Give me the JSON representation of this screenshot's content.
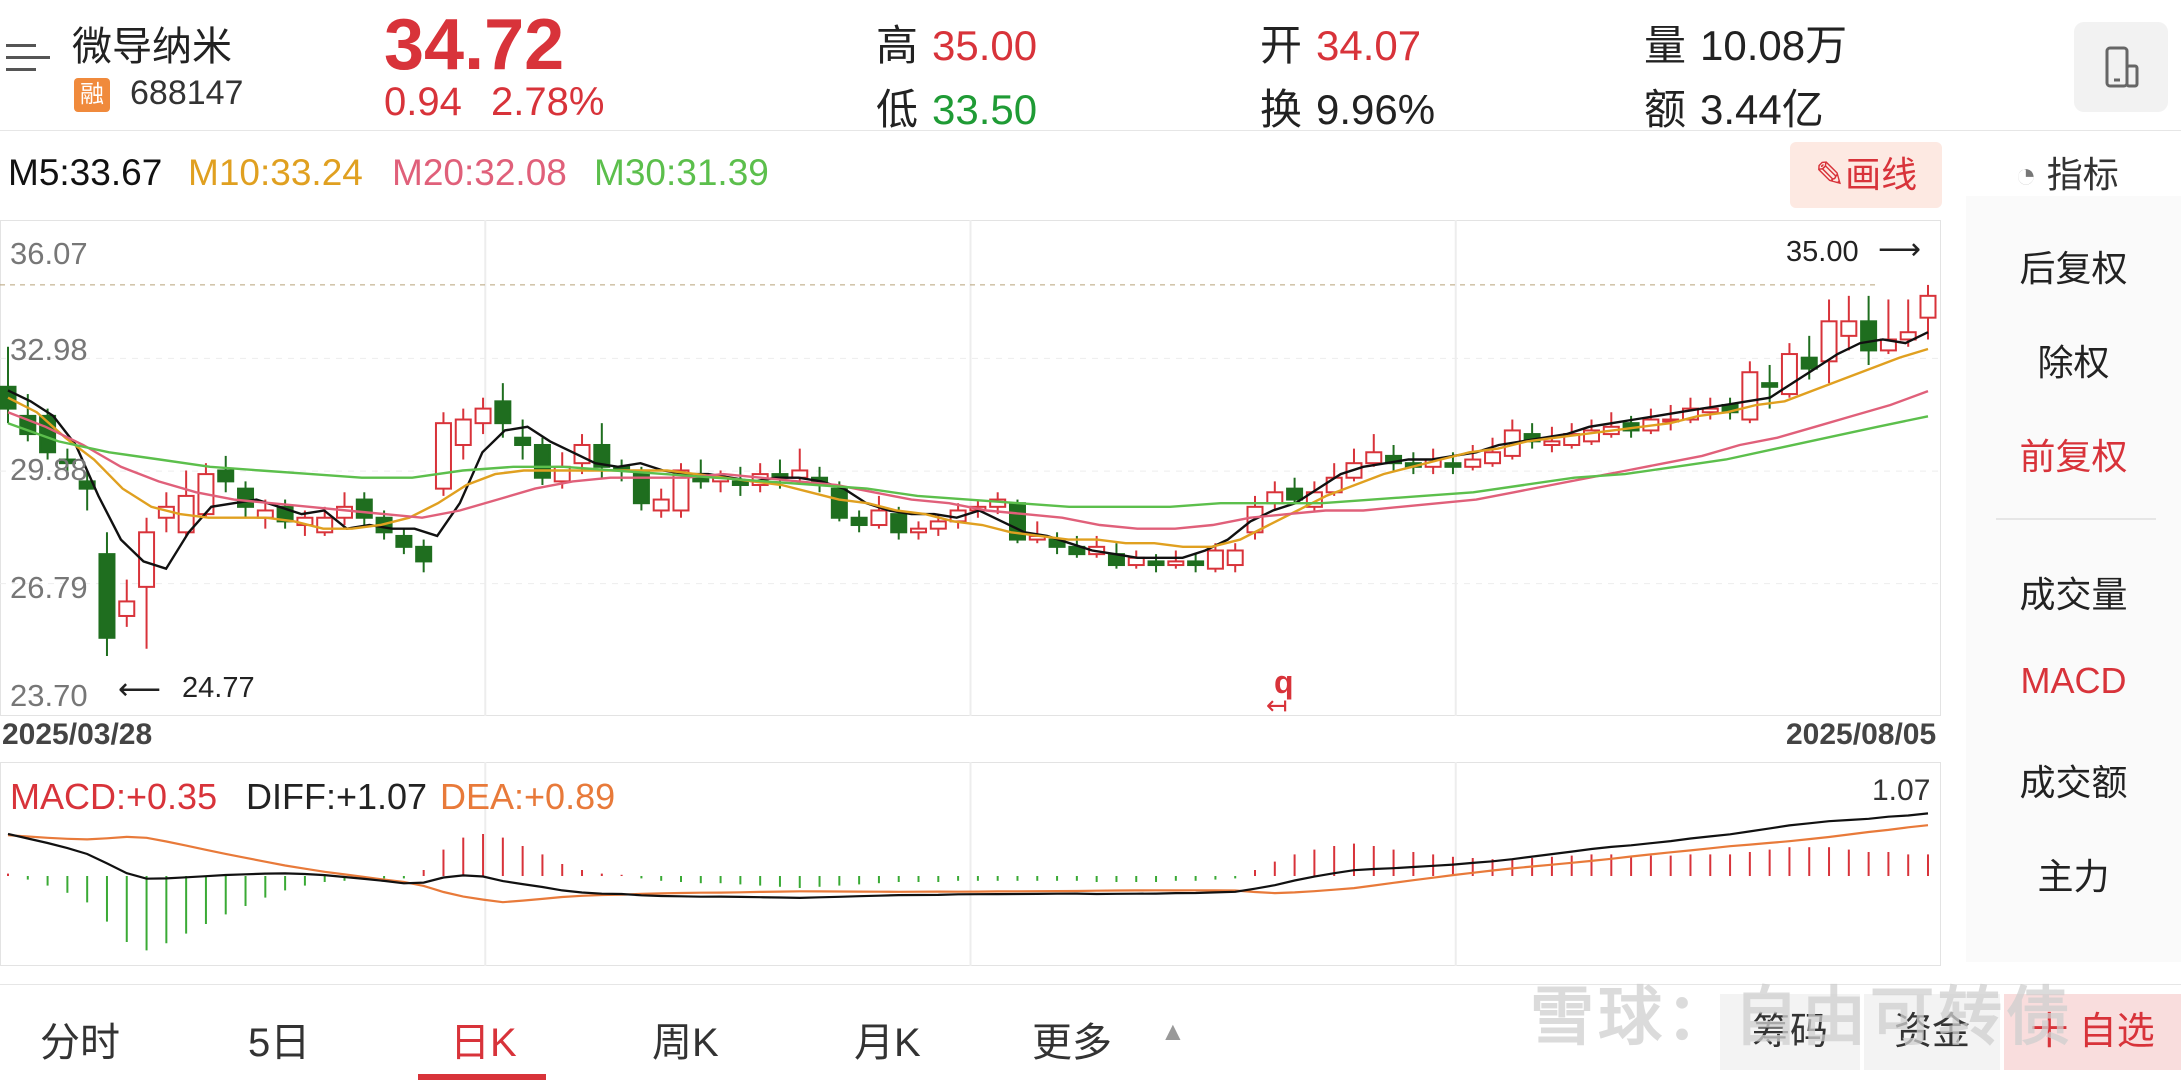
{
  "stock": {
    "name": "微导纳米",
    "badge": "融",
    "code": "688147",
    "price": "34.72",
    "change": "0.94",
    "change_pct": "2.78%"
  },
  "stats": {
    "high_label": "高",
    "high": "35.00",
    "low_label": "低",
    "low": "33.50",
    "open_label": "开",
    "open": "34.07",
    "turnover_label": "换",
    "turnover": "9.96%",
    "volume_label": "量",
    "volume": "10.08万",
    "amount_label": "额",
    "amount": "3.44亿"
  },
  "ma": {
    "m5": "M5:33.67",
    "m10": "M10:33.24",
    "m20": "M20:32.08",
    "m30": "M30:31.39"
  },
  "toolbar": {
    "draw_label": "画线",
    "indicator_label": "指标"
  },
  "side_menu": {
    "items": [
      "后复权",
      "除权",
      "前复权",
      "成交量",
      "MACD",
      "成交额",
      "主力"
    ],
    "active": [
      "前复权",
      "MACD"
    ]
  },
  "chart": {
    "y_ticks": [
      "36.07",
      "32.98",
      "29.88",
      "26.79",
      "23.70"
    ],
    "max_label": "35.00",
    "min_label": "24.77",
    "start_date": "2025/03/28",
    "end_date": "2025/08/05",
    "marker_label": "q"
  },
  "macd": {
    "macd": "MACD:+0.35",
    "diff": "DIFF:+1.07",
    "dea": "DEA:+0.89",
    "top_value": "1.07"
  },
  "tabs": [
    "分时",
    "5日",
    "日K",
    "周K",
    "月K",
    "更多"
  ],
  "active_tab": "日K",
  "bottom_buttons": {
    "chips": "筹码",
    "funds": "资金",
    "add": "十 自选"
  },
  "watermark": "雪球：自由可转债",
  "colors": {
    "up": "#d8333a",
    "down": "#1f6e1f",
    "m5": "#111111",
    "m10": "#e0a020",
    "m20": "#e0607a",
    "m30": "#5cbf4c",
    "dea": "#e87a3a"
  },
  "chart_data": {
    "type": "candlestick",
    "ylim": [
      23.7,
      36.07
    ],
    "candles": [
      [
        32.2,
        31.6,
        33.3,
        31.2
      ],
      [
        31.4,
        30.9,
        32.0,
        30.7
      ],
      [
        31.4,
        30.4,
        31.6,
        30.2
      ],
      [
        30.2,
        30.1,
        30.5,
        29.8
      ],
      [
        29.6,
        29.4,
        29.9,
        28.8
      ],
      [
        27.6,
        25.3,
        28.2,
        24.8
      ],
      [
        25.9,
        26.3,
        26.9,
        25.6
      ],
      [
        26.7,
        28.2,
        28.6,
        25.0
      ],
      [
        28.6,
        28.9,
        29.3,
        28.2
      ],
      [
        28.2,
        29.2,
        29.9,
        28.1
      ],
      [
        28.7,
        29.8,
        30.1,
        28.6
      ],
      [
        29.9,
        29.6,
        30.3,
        29.3
      ],
      [
        29.4,
        28.9,
        29.6,
        28.6
      ],
      [
        28.6,
        28.8,
        29.1,
        28.3
      ],
      [
        28.9,
        28.5,
        29.1,
        28.3
      ],
      [
        28.4,
        28.6,
        28.8,
        28.1
      ],
      [
        28.2,
        28.6,
        28.9,
        28.1
      ],
      [
        28.6,
        28.9,
        29.3,
        28.4
      ],
      [
        29.1,
        28.6,
        29.3,
        28.4
      ],
      [
        28.6,
        28.2,
        28.8,
        28.0
      ],
      [
        28.1,
        27.8,
        28.3,
        27.6
      ],
      [
        27.8,
        27.4,
        28.0,
        27.1
      ],
      [
        29.4,
        31.2,
        31.5,
        29.2
      ],
      [
        30.6,
        31.3,
        31.6,
        30.2
      ],
      [
        31.2,
        31.6,
        31.9,
        30.9
      ],
      [
        31.8,
        31.2,
        32.3,
        30.8
      ],
      [
        30.8,
        30.6,
        31.3,
        30.2
      ],
      [
        30.6,
        29.7,
        30.8,
        29.5
      ],
      [
        29.6,
        30.0,
        30.4,
        29.4
      ],
      [
        30.1,
        30.6,
        30.9,
        29.8
      ],
      [
        30.6,
        30.0,
        31.2,
        29.7
      ],
      [
        30.0,
        29.9,
        30.2,
        29.6
      ],
      [
        29.9,
        29.0,
        30.0,
        28.8
      ],
      [
        28.8,
        29.1,
        29.4,
        28.6
      ],
      [
        28.8,
        29.9,
        30.1,
        28.6
      ],
      [
        29.8,
        29.6,
        30.2,
        29.4
      ],
      [
        29.6,
        29.7,
        29.9,
        29.3
      ],
      [
        29.6,
        29.5,
        30.0,
        29.2
      ],
      [
        29.5,
        29.8,
        30.1,
        29.3
      ],
      [
        29.8,
        29.7,
        30.2,
        29.4
      ],
      [
        29.7,
        29.9,
        30.5,
        29.5
      ],
      [
        29.7,
        29.6,
        30.0,
        29.3
      ],
      [
        29.4,
        28.6,
        29.6,
        28.5
      ],
      [
        28.6,
        28.4,
        28.8,
        28.2
      ],
      [
        28.4,
        28.8,
        29.2,
        28.3
      ],
      [
        28.7,
        28.2,
        28.9,
        28.0
      ],
      [
        28.2,
        28.3,
        28.5,
        28.0
      ],
      [
        28.3,
        28.5,
        28.7,
        28.1
      ],
      [
        28.5,
        28.8,
        29.0,
        28.3
      ],
      [
        28.8,
        28.9,
        29.1,
        28.6
      ],
      [
        28.9,
        29.1,
        29.3,
        28.7
      ],
      [
        29.0,
        28.0,
        29.1,
        27.9
      ],
      [
        28.0,
        28.1,
        28.5,
        27.9
      ],
      [
        28.0,
        27.8,
        28.2,
        27.6
      ],
      [
        27.8,
        27.6,
        28.1,
        27.5
      ],
      [
        27.6,
        27.8,
        28.1,
        27.5
      ],
      [
        27.6,
        27.3,
        27.9,
        27.2
      ],
      [
        27.3,
        27.5,
        27.7,
        27.2
      ],
      [
        27.4,
        27.3,
        27.6,
        27.1
      ],
      [
        27.3,
        27.4,
        27.7,
        27.2
      ],
      [
        27.4,
        27.3,
        27.6,
        27.1
      ],
      [
        27.2,
        27.7,
        27.9,
        27.1
      ],
      [
        27.3,
        27.7,
        27.9,
        27.1
      ],
      [
        28.2,
        28.9,
        29.2,
        28.0
      ],
      [
        29.0,
        29.3,
        29.6,
        28.8
      ],
      [
        29.4,
        29.1,
        29.7,
        29.0
      ],
      [
        28.9,
        29.3,
        29.6,
        28.8
      ],
      [
        29.3,
        29.7,
        30.1,
        29.2
      ],
      [
        29.7,
        30.1,
        30.5,
        29.6
      ],
      [
        30.1,
        30.4,
        30.9,
        30.0
      ],
      [
        30.3,
        30.1,
        30.6,
        29.9
      ],
      [
        30.1,
        30.0,
        30.4,
        29.8
      ],
      [
        30.0,
        30.2,
        30.5,
        29.8
      ],
      [
        30.1,
        30.0,
        30.4,
        29.8
      ],
      [
        30.0,
        30.2,
        30.6,
        29.9
      ],
      [
        30.1,
        30.4,
        30.8,
        30.0
      ],
      [
        30.3,
        31.0,
        31.3,
        30.2
      ],
      [
        30.9,
        30.7,
        31.2,
        30.5
      ],
      [
        30.6,
        30.7,
        31.1,
        30.4
      ],
      [
        30.6,
        30.9,
        31.2,
        30.5
      ],
      [
        30.7,
        31.0,
        31.3,
        30.6
      ],
      [
        30.9,
        31.1,
        31.5,
        30.8
      ],
      [
        31.2,
        31.0,
        31.4,
        30.8
      ],
      [
        31.0,
        31.3,
        31.6,
        30.9
      ],
      [
        31.3,
        31.3,
        31.7,
        31.0
      ],
      [
        31.3,
        31.6,
        31.9,
        31.2
      ],
      [
        31.5,
        31.6,
        31.9,
        31.3
      ],
      [
        31.7,
        31.5,
        31.9,
        31.3
      ],
      [
        31.3,
        32.6,
        32.9,
        31.2
      ],
      [
        32.3,
        32.2,
        32.8,
        31.6
      ],
      [
        32.0,
        33.1,
        33.4,
        31.9
      ],
      [
        33.0,
        32.7,
        33.6,
        32.4
      ],
      [
        32.9,
        34.0,
        34.6,
        32.3
      ],
      [
        33.6,
        34.0,
        34.7,
        33.2
      ],
      [
        34.0,
        33.2,
        34.7,
        32.8
      ],
      [
        33.2,
        33.5,
        34.6,
        33.1
      ],
      [
        33.5,
        33.7,
        34.6,
        33.3
      ],
      [
        34.1,
        34.7,
        35.0,
        33.5
      ]
    ],
    "ma_lines": [
      {
        "name": "M5",
        "values": [
          32.1,
          31.8,
          31.4,
          30.6,
          29.2,
          28.0,
          27.4,
          27.2,
          28.2,
          28.9,
          29.0,
          29.1,
          28.9,
          28.7,
          28.8,
          28.3,
          28.4,
          28.3,
          28.3,
          28.1,
          29.0,
          30.4,
          31.0,
          31.1,
          30.7,
          30.4,
          30.1,
          30.0,
          30.1,
          29.9,
          29.8,
          29.8,
          29.7,
          29.6,
          29.7,
          29.7,
          29.6,
          29.4,
          29.0,
          28.8,
          28.7,
          28.7,
          28.6,
          28.8,
          28.5,
          28.2,
          28.1,
          27.9,
          27.7,
          27.6,
          27.5,
          27.5,
          27.5,
          27.7,
          28.0,
          28.5,
          28.8,
          29.0,
          29.4,
          29.8,
          30.0,
          30.1,
          30.2,
          30.2,
          30.3,
          30.4,
          30.6,
          30.7,
          30.8,
          30.9,
          31.1,
          31.2,
          31.3,
          31.4,
          31.5,
          31.6,
          31.7,
          31.8,
          31.9,
          32.3,
          32.7,
          33.1,
          33.4,
          33.5,
          33.4,
          33.7
        ]
      },
      {
        "name": "M10",
        "values": [
          31.9,
          31.5,
          30.8,
          30.2,
          29.4,
          28.9,
          28.7,
          28.6,
          28.6,
          28.6,
          28.5,
          28.3,
          28.3,
          28.4,
          28.6,
          29.0,
          29.5,
          29.8,
          29.9,
          29.9,
          29.9,
          29.9,
          29.9,
          29.9,
          29.8,
          29.7,
          29.6,
          29.5,
          29.3,
          29.1,
          29.0,
          28.8,
          28.7,
          28.5,
          28.4,
          28.2,
          28.1,
          28.0,
          28.0,
          27.9,
          27.9,
          27.8,
          27.8,
          28.0,
          28.4,
          28.8,
          29.2,
          29.5,
          29.8,
          30.0,
          30.2,
          30.4,
          30.5,
          30.7,
          30.8,
          30.9,
          31.0,
          31.1,
          31.2,
          31.4,
          31.5,
          31.7,
          31.8,
          32.1,
          32.4,
          32.7,
          33.0,
          33.24
        ]
      },
      {
        "name": "M20",
        "values": [
          31.5,
          31.1,
          30.6,
          30.0,
          29.6,
          29.3,
          29.1,
          29.0,
          28.9,
          28.8,
          28.7,
          28.6,
          28.8,
          29.1,
          29.4,
          29.6,
          29.7,
          29.7,
          29.7,
          29.8,
          29.7,
          29.6,
          29.5,
          29.3,
          29.1,
          29.0,
          28.8,
          28.7,
          28.6,
          28.4,
          28.3,
          28.3,
          28.4,
          28.6,
          28.7,
          28.8,
          28.8,
          28.9,
          29.0,
          29.1,
          29.3,
          29.5,
          29.7,
          29.9,
          30.1,
          30.3,
          30.6,
          30.8,
          31.1,
          31.4,
          31.7,
          32.08
        ]
      },
      {
        "name": "M30",
        "values": [
          31.2,
          30.7,
          30.4,
          30.2,
          30.0,
          29.9,
          29.8,
          29.7,
          29.7,
          29.9,
          30.0,
          30.0,
          29.9,
          29.8,
          29.7,
          29.6,
          29.5,
          29.4,
          29.2,
          29.1,
          29.0,
          28.9,
          28.9,
          28.9,
          29.0,
          29.0,
          29.0,
          29.1,
          29.2,
          29.3,
          29.5,
          29.7,
          29.8,
          30.0,
          30.2,
          30.5,
          30.8,
          31.1,
          31.39
        ]
      }
    ],
    "macd_bars": [
      0.02,
      -0.03,
      -0.08,
      -0.14,
      -0.22,
      -0.38,
      -0.55,
      -0.62,
      -0.56,
      -0.48,
      -0.4,
      -0.32,
      -0.25,
      -0.18,
      -0.12,
      -0.08,
      -0.05,
      -0.04,
      -0.03,
      -0.02,
      -0.02,
      0.05,
      0.22,
      0.32,
      0.35,
      0.32,
      0.25,
      0.18,
      0.1,
      0.05,
      0.02,
      0.01,
      -0.02,
      -0.04,
      -0.05,
      -0.06,
      -0.06,
      -0.07,
      -0.08,
      -0.09,
      -0.1,
      -0.09,
      -0.08,
      -0.07,
      -0.06,
      -0.05,
      -0.05,
      -0.05,
      -0.04,
      -0.04,
      -0.04,
      -0.04,
      -0.04,
      -0.04,
      -0.04,
      -0.05,
      -0.05,
      -0.05,
      -0.05,
      -0.04,
      -0.04,
      -0.03,
      -0.02,
      0.05,
      0.12,
      0.18,
      0.22,
      0.25,
      0.27,
      0.25,
      0.22,
      0.2,
      0.18,
      0.16,
      0.15,
      0.14,
      0.14,
      0.15,
      0.16,
      0.17,
      0.18,
      0.18,
      0.17,
      0.17,
      0.17,
      0.18,
      0.18,
      0.18,
      0.2,
      0.22,
      0.24,
      0.24,
      0.24,
      0.22,
      0.2,
      0.2,
      0.18,
      0.18
    ]
  }
}
